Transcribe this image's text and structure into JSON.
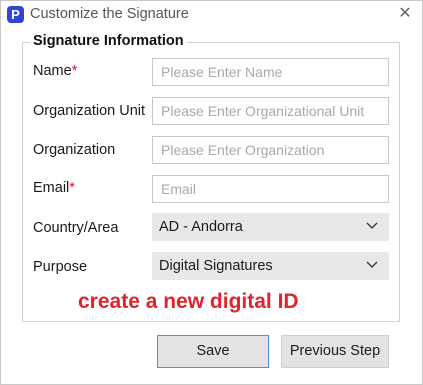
{
  "window": {
    "app_icon_glyph": "P",
    "title": "Customize the Signature",
    "close_glyph": "✕"
  },
  "section": {
    "title": "Signature Information"
  },
  "form": {
    "name": {
      "label": "Name",
      "required_mark": "*",
      "placeholder": "Please Enter Name",
      "value": ""
    },
    "org_unit": {
      "label": "Organization Unit",
      "placeholder": "Please Enter Organizational Unit",
      "value": ""
    },
    "organization": {
      "label": "Organization",
      "placeholder": "Please Enter Organization",
      "value": ""
    },
    "email": {
      "label": "Email",
      "required_mark": "*",
      "placeholder": "Email",
      "value": ""
    },
    "country": {
      "label": "Country/Area",
      "selected": "AD - Andorra"
    },
    "purpose": {
      "label": "Purpose",
      "selected": "Digital Signatures"
    }
  },
  "annotation": "create a new digital ID",
  "buttons": {
    "save": "Save",
    "previous": "Previous Step"
  },
  "colors": {
    "accent": "#2f45d6",
    "required": "#d11a2a",
    "annotation": "#e0242e",
    "focus_border": "#4a8fe0"
  }
}
